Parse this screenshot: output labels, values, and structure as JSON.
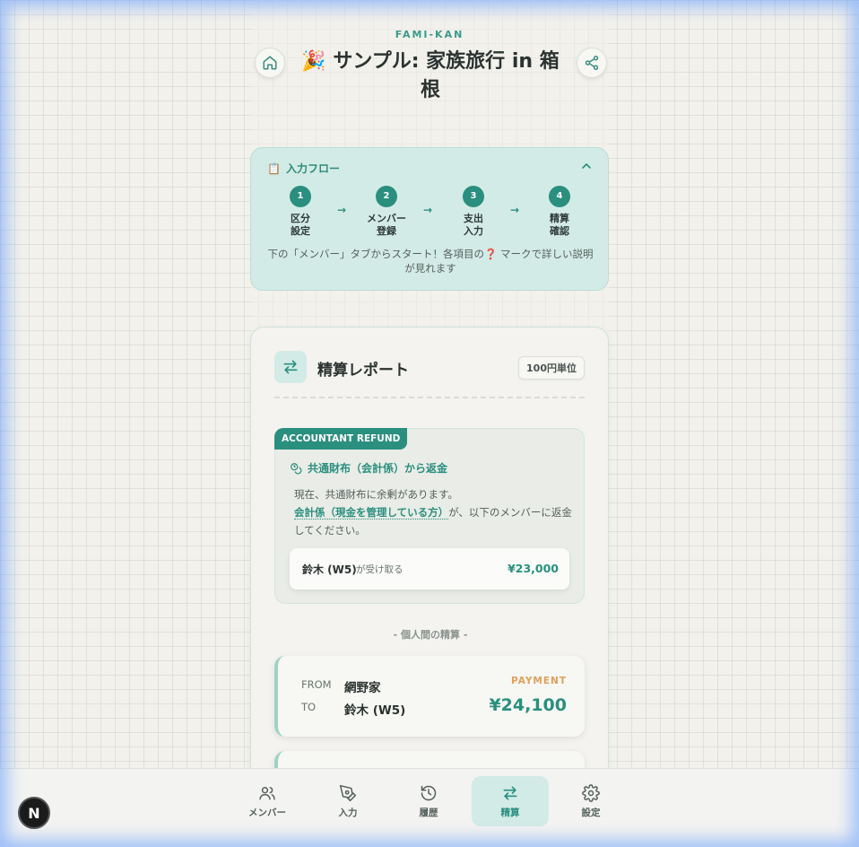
{
  "header": {
    "brand": "FAMI-KAN",
    "title_emoji": "🎉",
    "title": "サンプル: 家族旅行 in 箱根"
  },
  "flow": {
    "clip_emoji": "📋",
    "heading": "入力フロー",
    "steps": [
      {
        "num": "1",
        "label": "区分\n設定"
      },
      {
        "num": "2",
        "label": "メンバー\n登録"
      },
      {
        "num": "3",
        "label": "支出\n入力"
      },
      {
        "num": "4",
        "label": "精算\n確認"
      }
    ],
    "arrow": "→",
    "note": "下の「メンバー」タブからスタート！各項目の❓ マークで詳しい説明が見れます"
  },
  "report": {
    "title": "精算レポート",
    "unit_badge": "100円単位",
    "refund": {
      "tag": "ACCOUNTANT REFUND",
      "heading": "共通財布（会計係）から返金",
      "line1": "現在、共通財布に余剰があります。",
      "link": "会計係（現金を管理している方）",
      "line2_after_link": "が、以下のメンバーに返金してください。",
      "receiver": "鈴木 (W5)",
      "receive_label": "が受け取る",
      "amount": "¥23,000"
    },
    "divider": "- 個人間の精算 -",
    "payment": {
      "from_label": "FROM",
      "to_label": "TO",
      "from": "網野家",
      "to": "鈴木 (W5)",
      "tag": "PAYMENT",
      "amount": "¥24,100"
    }
  },
  "nav": {
    "items": [
      {
        "label": "メンバー",
        "icon": "users-icon"
      },
      {
        "label": "入力",
        "icon": "pen-icon"
      },
      {
        "label": "履歴",
        "icon": "history-icon"
      },
      {
        "label": "精算",
        "icon": "transfer-icon"
      },
      {
        "label": "設定",
        "icon": "gear-icon"
      }
    ],
    "active": "精算"
  },
  "dev_badge": "N",
  "colors": {
    "accent": "#2a8f7f",
    "accent_light": "#d3ebe6",
    "payment_tag": "#e0a05c"
  }
}
